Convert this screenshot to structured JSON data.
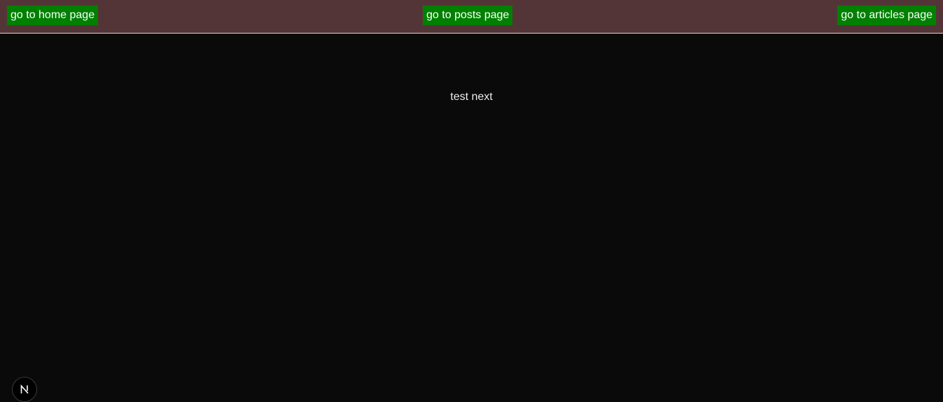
{
  "nav": {
    "home_label": "go to home page",
    "posts_label": "go to posts page",
    "articles_label": "go to articles page"
  },
  "main": {
    "text": "test next"
  },
  "dev_indicator": {
    "icon": "nextjs-logo-icon"
  },
  "colors": {
    "header_bg": "#543537",
    "link_bg": "#008000",
    "page_bg": "#0a0a0a",
    "text": "#ededed"
  }
}
